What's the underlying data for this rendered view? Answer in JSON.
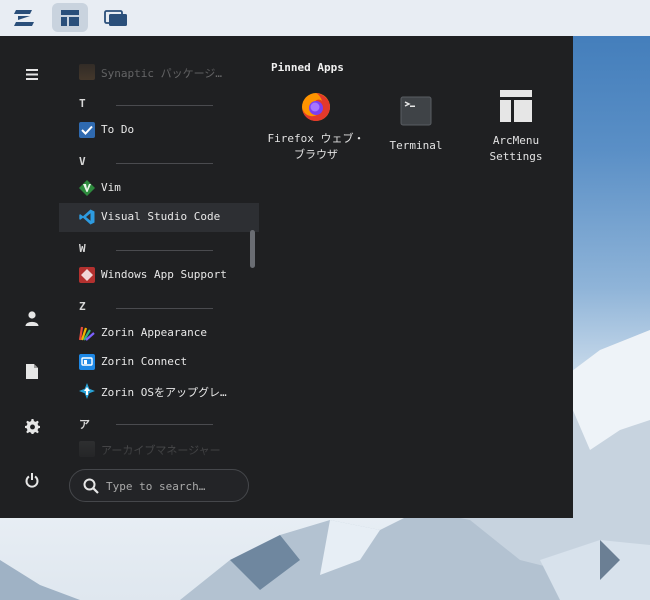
{
  "topbar": {
    "buttons": [
      {
        "name": "zorin-menu-button",
        "icon": "zorin-logo-icon"
      },
      {
        "name": "arcmenu-layout-button",
        "icon": "layout-icon",
        "active": true
      },
      {
        "name": "workspaces-button",
        "icon": "windows-icon"
      }
    ]
  },
  "sidebar": {
    "items": [
      {
        "icon": "hamburger-menu-icon",
        "label": "Menu"
      },
      {
        "icon": "user-icon",
        "label": "Home"
      },
      {
        "icon": "document-icon",
        "label": "Documents"
      },
      {
        "icon": "gear-icon",
        "label": "Settings"
      },
      {
        "icon": "power-icon",
        "label": "Power"
      }
    ]
  },
  "app_list": {
    "synaptic": "Synaptic パッケージ…",
    "header_t": "T",
    "todo": "To Do",
    "header_v": "V",
    "vim": "Vim",
    "vscode": "Visual Studio Code",
    "header_w": "W",
    "windows_app_support": "Windows App Support",
    "header_z": "Z",
    "zorin_appearance": "Zorin Appearance",
    "zorin_connect": "Zorin Connect",
    "zorin_upgrade": "Zorin OSをアップグレ…",
    "header_a": "ア",
    "archive_manager": "アーカイブマネージャー"
  },
  "search": {
    "placeholder": "Type to search…"
  },
  "pinned": {
    "title": "Pinned Apps",
    "apps": [
      {
        "label": "Firefox ウェブ・ブラウザ",
        "icon": "firefox-icon"
      },
      {
        "label": "Terminal",
        "icon": "terminal-icon"
      },
      {
        "label": "ArcMenu Settings",
        "icon": "arcmenu-settings-icon"
      }
    ]
  },
  "colors": {
    "menu_bg": "#1f2022",
    "topbar_bg": "#e8edf3",
    "selected_row": "#2d2f33",
    "accent": "#1e88e5"
  }
}
